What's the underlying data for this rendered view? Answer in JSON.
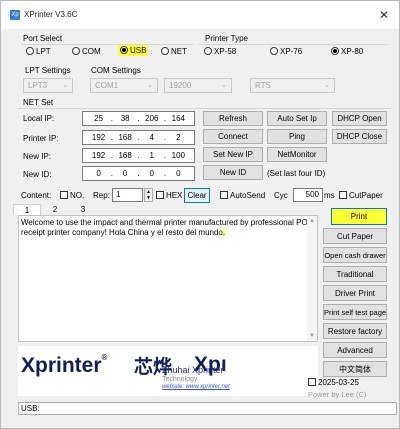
{
  "window": {
    "title": "XPrinter V3.6C",
    "icon": "Xp"
  },
  "port_select": {
    "title": "Port Select",
    "options": [
      "LPT",
      "COM",
      "USB",
      "NET"
    ],
    "selected": "USB"
  },
  "printer_type": {
    "title": "Printer Type",
    "options": [
      "XP-58",
      "XP-76",
      "XP-80"
    ],
    "selected": "XP-80"
  },
  "lpt_settings": {
    "title": "LPT Settings",
    "value": "LPT3"
  },
  "com_settings": {
    "title": "COM Settings",
    "port": "COM1",
    "baud": "19200",
    "flow": "RTS"
  },
  "net_set": {
    "title": "NET Set",
    "local_ip": {
      "label": "Local IP:",
      "octets": [
        "25",
        "38",
        "206",
        "164"
      ]
    },
    "printer_ip": {
      "label": "Printer IP:",
      "octets": [
        "192",
        "168",
        "4",
        "2"
      ]
    },
    "new_ip": {
      "label": "New IP:",
      "octets": [
        "192",
        "168",
        "1",
        "100"
      ]
    },
    "new_id": {
      "label": "New ID:",
      "octets": [
        "0",
        "0",
        "0",
        "0"
      ]
    }
  },
  "net_buttons": {
    "refresh": "Refresh",
    "auto_set_ip": "Auto Set Ip",
    "dhcp_open": "DHCP Open",
    "connect": "Connect",
    "ping": "Ping",
    "dhcp_close": "DHCP Close",
    "set_new_ip": "Set New IP",
    "net_monitor": "NetMonitor",
    "new_id": "New ID",
    "set_last_four": "(Set last four ID)"
  },
  "content_row": {
    "content_label": "Content:",
    "no_label": "NO.",
    "rep_label": "Rep:",
    "rep_value": "1",
    "hex_label": "HEX",
    "clear_label": "Clear",
    "autosend_label": "AutoSend",
    "cyc_label": "Cyc",
    "cyc_value": "500",
    "ms_label": "ms",
    "cutpaper_label": "CutPaper"
  },
  "tabs": [
    "1",
    "2",
    "3"
  ],
  "message": {
    "text": "Welcome to use the impact and thermal printer manufactured by professional POS receipt printer company! Hola China y el resto del mundo",
    "highlighted_tail": "."
  },
  "side_buttons": {
    "print": "Print",
    "cut_paper": "Cut Paper",
    "open_cash_drawer": "Open cash drawer",
    "traditional": "Traditional",
    "driver_print": "Driver Print",
    "print_self_test": "Print self test page",
    "restore_factory": "Restore factory",
    "advanced": "Advanced",
    "chinese": "中文简体"
  },
  "logo": {
    "brand": "Xprinter",
    "reg": "®",
    "brand_cn": "芯烨",
    "brand_tail": "Xpı",
    "company": "Zhuhai Xprinter",
    "company_line2": "Technology",
    "website": "website: www.xprinter.net"
  },
  "footer": {
    "date": "2025-03-25",
    "powered_by": "Power by Lee (C)"
  },
  "status_bar": {
    "text": "USB:"
  }
}
